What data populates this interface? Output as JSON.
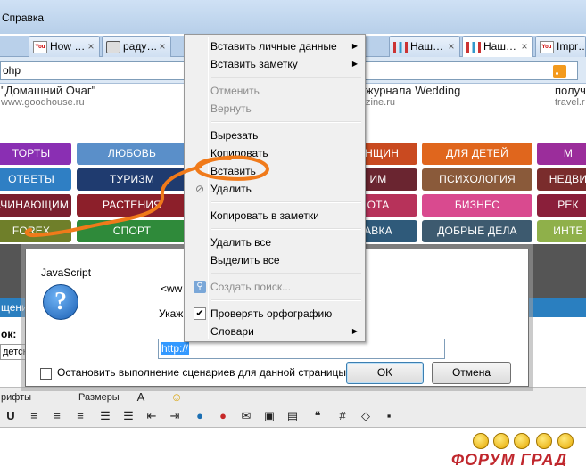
{
  "browser": {
    "menu_help": "Справка",
    "tabs": [
      {
        "label": "How …",
        "icon": "youtube-icon"
      },
      {
        "label": "раду…",
        "icon": "camera-icon"
      },
      {
        "label": "Наш…",
        "icon": "bars-icon"
      },
      {
        "label": "Наш…",
        "icon": "bars-icon",
        "active": true
      },
      {
        "label": "Impr…",
        "icon": "youtube-icon"
      }
    ],
    "url_fragment": "ohp"
  },
  "page": {
    "sites": [
      {
        "title": "\"Домашний Очаг\"",
        "url": "www.goodhouse.ru"
      },
      {
        "title": "журнала Wedding",
        "url": "zine.ru"
      },
      {
        "title": "получ",
        "url": "travel.r"
      }
    ],
    "categories": {
      "row1": [
        "ТОРТЫ",
        "ЛЮБОВЬ",
        "ЕНЩИН",
        "ДЛЯ ДЕТЕЙ",
        "М"
      ],
      "row2": [
        "ОТВЕТЫ",
        "ТУРИЗМ",
        "ИМ",
        "ПСИХОЛОГИЯ",
        "НЕДВИ"
      ],
      "row3": [
        "АЧИНАЮЩИМ",
        "РАСТЕНИЯ",
        "ОТА",
        "БИЗНЕС",
        "РЕК"
      ],
      "row4": [
        "FOREX",
        "СПОРТ",
        "АВКА",
        "ДОБРЫЕ ДЕЛА",
        "ИНТЕ"
      ]
    },
    "form": {
      "band_label": "щение",
      "label_left": "ок:",
      "field_value": "детск",
      "fonts_label": "рифты",
      "sizes_label": "Размеры"
    },
    "forum_logo": "ФОРУМ ГРАД"
  },
  "dialog": {
    "title": "JavaScript",
    "message_line1": "<ww",
    "message_line2": "Укаж",
    "input_value": "http://",
    "checkbox_label": "Остановить выполнение сценариев для данной страницы",
    "ok_label": "OK",
    "cancel_label": "Отмена"
  },
  "context_menu": {
    "items": [
      {
        "label": "Вставить личные данные",
        "submenu": true
      },
      {
        "label": "Вставить заметку",
        "submenu": true
      },
      {
        "label": "Отменить",
        "disabled": true
      },
      {
        "label": "Вернуть",
        "disabled": true
      },
      {
        "label": "Вырезать"
      },
      {
        "label": "Копировать"
      },
      {
        "label": "Вставить"
      },
      {
        "label": "Удалить",
        "icon": "no-entry-icon"
      },
      {
        "label": "Копировать в заметки"
      },
      {
        "label": "Удалить все"
      },
      {
        "label": "Выделить все"
      },
      {
        "label": "Создать поиск...",
        "disabled": true,
        "icon": "search-icon"
      },
      {
        "label": "Проверять орфографию",
        "checked": true
      },
      {
        "label": "Словари",
        "submenu": true
      }
    ]
  },
  "colors": {
    "annotation": "#f07a1a",
    "accent_blue": "#2a7fc0"
  }
}
